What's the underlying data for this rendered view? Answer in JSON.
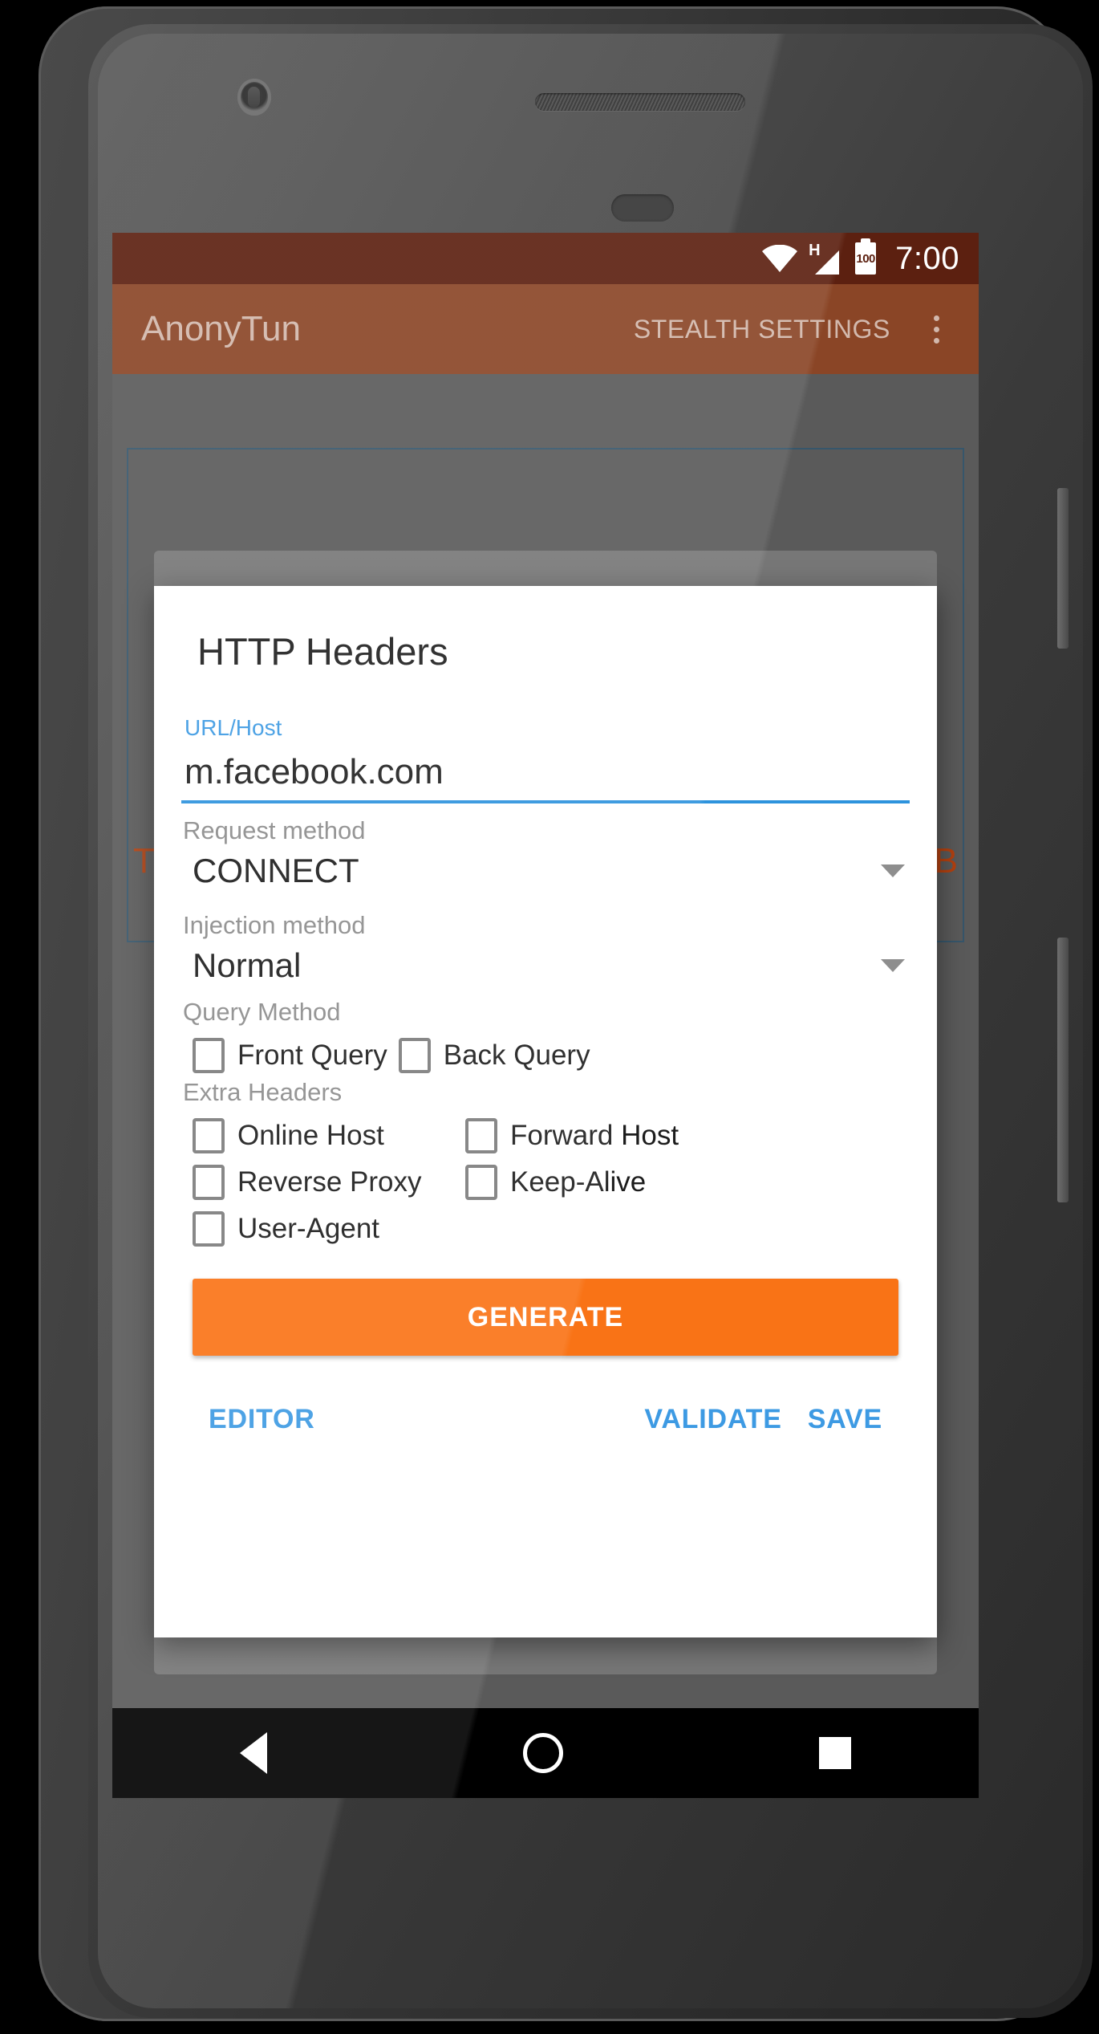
{
  "status_bar": {
    "wifi_icon": "wifi-icon",
    "signal_icon": "signal-h-icon",
    "signal_letter": "H",
    "battery_icon": "battery-icon",
    "battery_percent": "100",
    "clock": "7:00"
  },
  "app_bar": {
    "title": "AnonyTun",
    "stealth_settings_label": "STEALTH SETTINGS",
    "overflow_icon": "overflow-menu-icon"
  },
  "background_app": {
    "tx_label": "TX",
    "kb_label": "KB"
  },
  "dialog": {
    "title": "HTTP Headers",
    "url_host": {
      "label": "URL/Host",
      "value": "m.facebook.com",
      "placeholder": "URL/Host"
    },
    "request_method": {
      "label": "Request method",
      "value": "CONNECT",
      "caret_icon": "chevron-down-icon"
    },
    "injection_method": {
      "label": "Injection method",
      "value": "Normal",
      "caret_icon": "chevron-down-icon"
    },
    "query_method": {
      "label": "Query Method",
      "options": [
        {
          "label": "Front Query",
          "checked": false
        },
        {
          "label": "Back Query",
          "checked": false
        }
      ]
    },
    "extra_headers": {
      "label": "Extra Headers",
      "options": [
        {
          "label": "Online Host",
          "checked": false
        },
        {
          "label": "Forward Host",
          "checked": false
        },
        {
          "label": "Reverse Proxy",
          "checked": false
        },
        {
          "label": "Keep-Alive",
          "checked": false
        },
        {
          "label": "User-Agent",
          "checked": false
        }
      ]
    },
    "generate_label": "GENERATE",
    "actions": {
      "editor_label": "EDITOR",
      "validate_label": "VALIDATE",
      "save_label": "SAVE"
    }
  },
  "nav_bar": {
    "back_icon": "back-triangle-icon",
    "home_icon": "home-circle-icon",
    "recents_icon": "recents-square-icon"
  },
  "colors": {
    "accent_blue": "#3d9ae3",
    "generate_orange": "#F97316",
    "app_bar_brown": "#8a4526",
    "status_bar_brown": "#5c2010",
    "bg_orange_text": "#b4410f"
  }
}
